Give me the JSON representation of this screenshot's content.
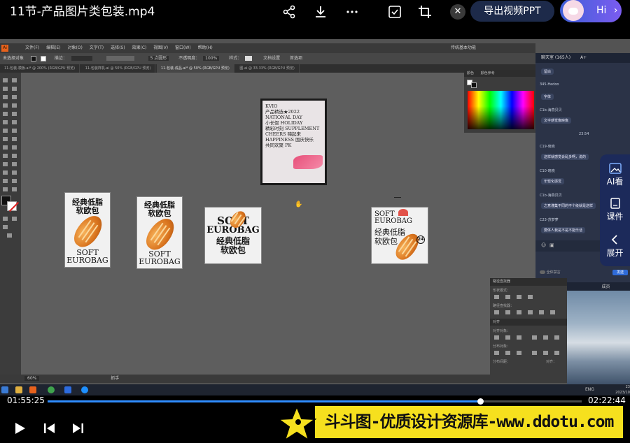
{
  "player": {
    "title": "11节-产品图片类包装.mp4",
    "export_label": "导出视频PPT",
    "hi_label": "Hi",
    "current_time": "01:55:25",
    "total_time": "02:22:44",
    "progress": 0.81
  },
  "illustrator": {
    "logo": "Ai",
    "menu": [
      "文件(F)",
      "编辑(E)",
      "对象(O)",
      "文字(T)",
      "选择(S)",
      "效果(C)",
      "视图(V)",
      "窗口(W)",
      "帮助(H)"
    ],
    "workspace": "传统基本功能",
    "ctrl_left": "未选择对象",
    "ctrl_stroke": "描边：",
    "ctrl_points": "5 点圆形",
    "ctrl_opacity": "不透明度：",
    "ctrl_opacity_val": "100%",
    "ctrl_style": "样式：",
    "ctrl_doc": "文档设置",
    "ctrl_pref": "首选项",
    "tabs": [
      "11-包装-模板.ai* @ 200% (RGB/GPU 预览)",
      "11-包装样机.ai @ 50% (RGB/GPU 预览)",
      "11-包装-成品.ai* @ 50% (RGB/GPU 预览)",
      "图.ai @ 33.33% (RGB/GPU 预览)"
    ],
    "zoom": "60%",
    "status_tool": "抓手",
    "color_tabs": [
      "颜色",
      "颜色参考"
    ],
    "align_tabs": [
      "对齐",
      "路径查找器"
    ],
    "align_labels": [
      "形状模式：",
      "路径查找器：",
      "对齐对象：",
      "分布对象：",
      "分布间距："
    ],
    "align_to": "对齐："
  },
  "posters": {
    "cn_title_line1": "经典低脂",
    "cn_title_line2": "软欧包",
    "en_line1": "SOFT",
    "en_line2": "EUROBAG",
    "badge": "24",
    "dark_poster_lines": [
      "KVIO",
      "产品精选★2022",
      "NATIONAL DAY",
      "小长假 HOLIDAY",
      "精彩时刻 SUPPLEMENT",
      "CHEERS 嗨起来",
      "HAPPINESS 国庆快乐",
      "共同欢聚 PK"
    ]
  },
  "chat": {
    "header": "聊天室 (165人)",
    "font_toggle": "A+",
    "messages": [
      {
        "user": "",
        "text": "留白"
      },
      {
        "user": "345-Hedoo",
        "text": "字体"
      },
      {
        "user": "C1b-海燕贝贝",
        "text": "文字感觉像映像"
      },
      {
        "user": "",
        "text": "23:54"
      },
      {
        "user": "C19-晓晓",
        "text": "这样就感觉会乱多啊，说的"
      },
      {
        "user": "C10-晓晓",
        "text": "年轻化感觉"
      },
      {
        "user": "C1b-海燕贝贝",
        "text": "之意谨集不同的不个级就是这样"
      },
      {
        "user": "C23-苏梦萝",
        "text": "要体人我是不是不能乐话"
      }
    ],
    "mute_all": "全体禁言",
    "send": "发送",
    "tab_chat": "聊天",
    "tab_members": "成员"
  },
  "side_widget": {
    "ai_label": "AI看",
    "courseware_label": "课件",
    "expand_label": "展开"
  },
  "taskbar": {
    "lang": "ENG",
    "time": "23:55",
    "date": "2023/10/11"
  },
  "watermark": {
    "text": "斗斗图-优质设计资源库-www.ddotu.com"
  }
}
